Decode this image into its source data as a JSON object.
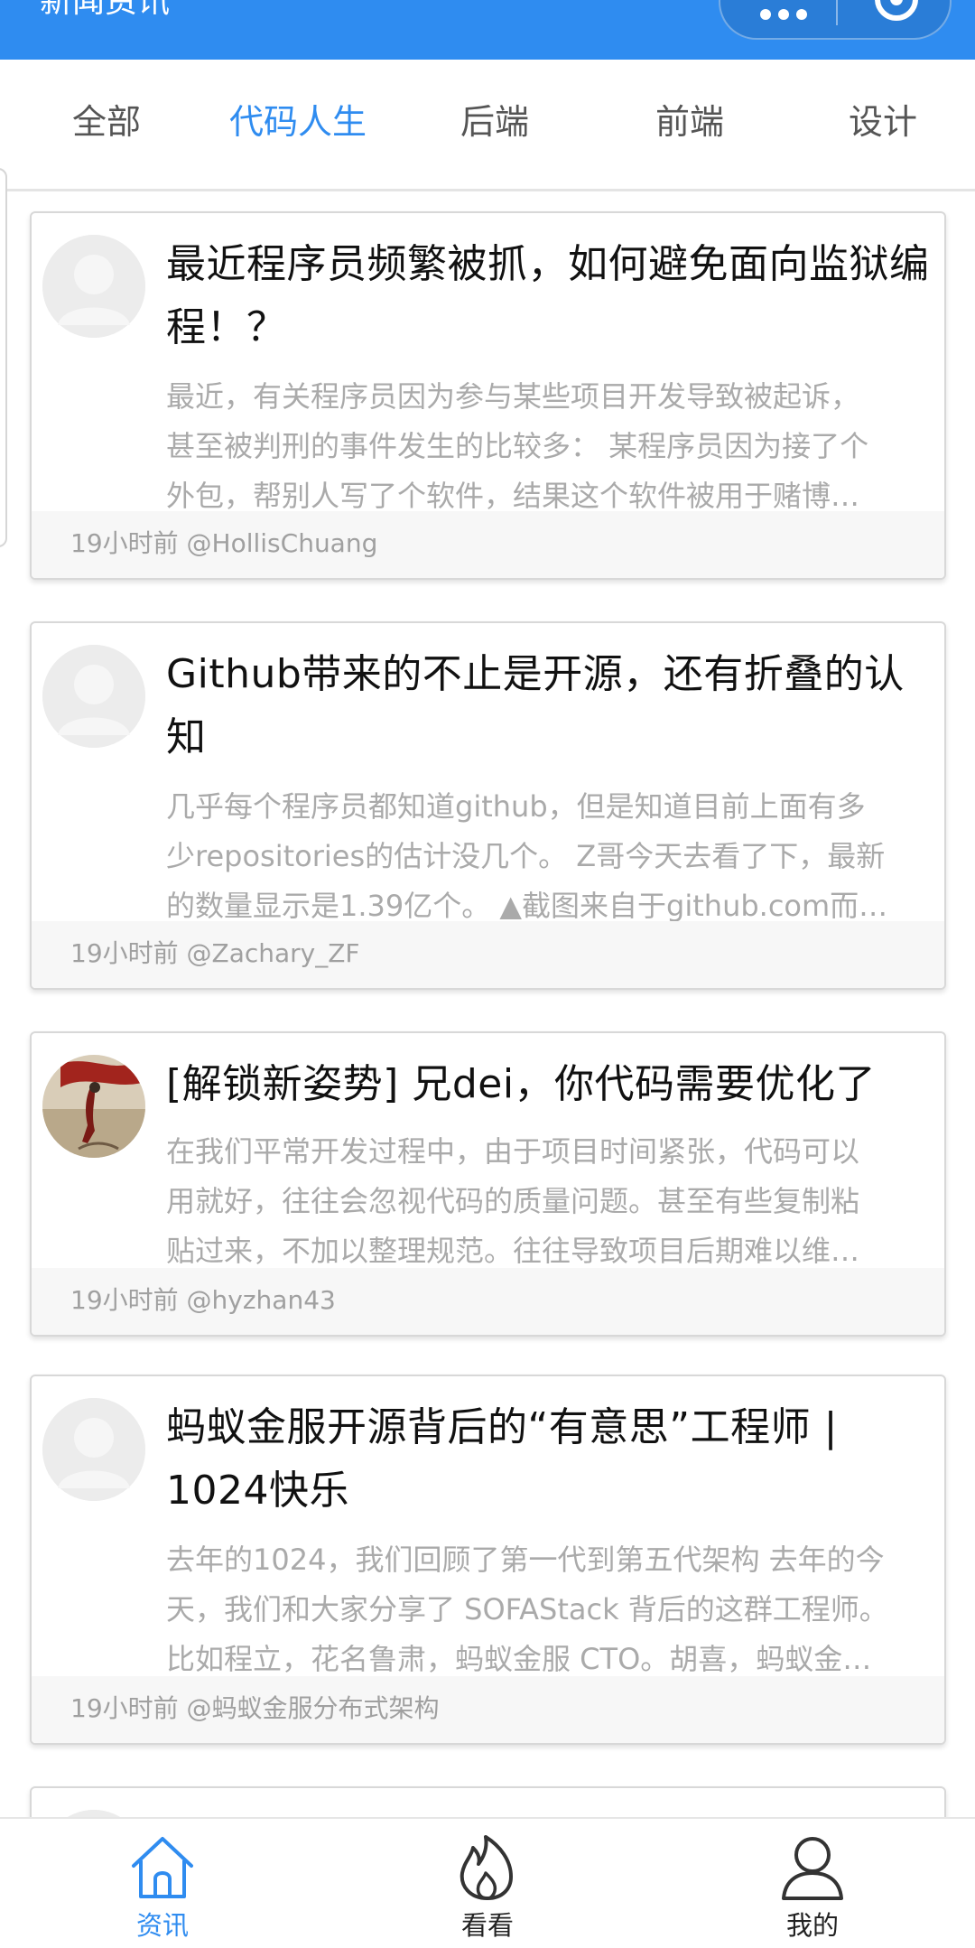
{
  "header": {
    "title": "新闻资讯"
  },
  "tabs": [
    {
      "label": "全部",
      "active": false
    },
    {
      "label": "代码人生",
      "active": true
    },
    {
      "label": "后端",
      "active": false
    },
    {
      "label": "前端",
      "active": false
    },
    {
      "label": "设计",
      "active": false
    }
  ],
  "articles": [
    {
      "title": "最近程序员频繁被抓，如何避免面向监狱编程！？",
      "desc": [
        "最近，有关程序员因为参与某些项目开发导致被起诉，",
        "甚至被判刑的事件发生的比较多： 某程序员因为接了个",
        "外包，帮别人写了个软件，结果这个软件被用于赌博…"
      ],
      "meta": "19小时前 @HollisChuang",
      "avatar": "default-avatar"
    },
    {
      "title": "Github带来的不止是开源，还有折叠的认知",
      "desc": [
        "几乎每个程序员都知道github，但是知道目前上面有多",
        "少repositories的估计没几个。 Z哥今天去看了下，最新",
        "的数量显示是1.39亿个。 ▲截图来自于github.com而…"
      ],
      "meta": "19小时前 @Zachary_ZF",
      "avatar": "default-avatar"
    },
    {
      "title": "[解锁新姿势] 兄dei，你代码需要优化了",
      "desc": [
        "在我们平常开发过程中，由于项目时间紧张，代码可以",
        "用就好，往往会忽视代码的质量问题。甚至有些复制粘",
        "贴过来，不加以整理规范。往往导致项目后期难以维…"
      ],
      "meta": "19小时前 @hyzhan43",
      "avatar": "photo-avatar"
    },
    {
      "title": "蚂蚁金服开源背后的“有意思”工程师 | 1024快乐",
      "desc": [
        "去年的1024，我们回顾了第一代到第五代架构 去年的今",
        "天，我们和大家分享了 SOFAStack 背后的这群工程师。",
        "比如程立，花名鲁肃，蚂蚁金服 CTO。胡喜，蚂蚁金…"
      ],
      "meta": "19小时前 @蚂蚁金服分布式架构",
      "avatar": "default-avatar"
    }
  ],
  "bottom_nav": [
    {
      "label": "资讯",
      "icon": "home-icon",
      "active": true
    },
    {
      "label": "看看",
      "icon": "flame-icon",
      "active": false
    },
    {
      "label": "我的",
      "icon": "person-icon",
      "active": false
    }
  ],
  "colors": {
    "accent": "#2f8cf0",
    "muted_text": "#aaaaaa"
  }
}
